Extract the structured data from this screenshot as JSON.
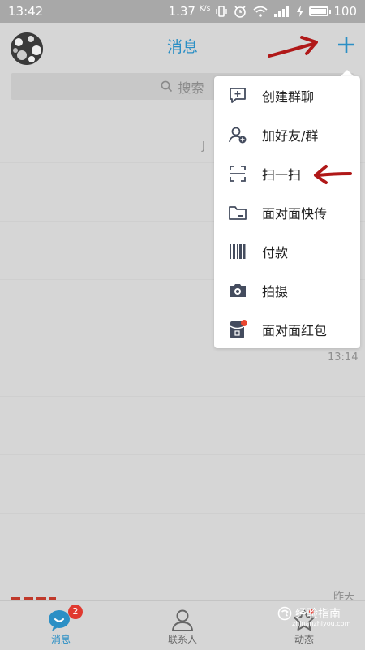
{
  "status_bar": {
    "time": "13:42",
    "speed": "1.37",
    "speed_unit": "K/s",
    "battery": "100"
  },
  "header": {
    "title": "消息"
  },
  "search": {
    "placeholder": "搜索"
  },
  "list": {
    "partial_chars": [
      "J",
      "13:14",
      "昨天"
    ]
  },
  "popup_menu": {
    "items": [
      {
        "label": "创建群聊",
        "icon": "create-group-chat-icon"
      },
      {
        "label": "加好友/群",
        "icon": "add-friend-icon"
      },
      {
        "label": "扫一扫",
        "icon": "scan-icon"
      },
      {
        "label": "面对面快传",
        "icon": "folder-transfer-icon"
      },
      {
        "label": "付款",
        "icon": "barcode-payment-icon"
      },
      {
        "label": "拍摄",
        "icon": "camera-icon"
      },
      {
        "label": "面对面红包",
        "icon": "red-packet-icon"
      }
    ]
  },
  "tab_bar": {
    "tabs": [
      {
        "label": "消息",
        "badge": "2"
      },
      {
        "label": "联系人"
      },
      {
        "label": "动态"
      }
    ]
  },
  "watermark": {
    "text": "经验指南",
    "sub": "zhinanzhiyou.com"
  },
  "colors": {
    "accent": "#2b8fc5",
    "annotation": "#b01818",
    "badge": "#e0392f"
  }
}
